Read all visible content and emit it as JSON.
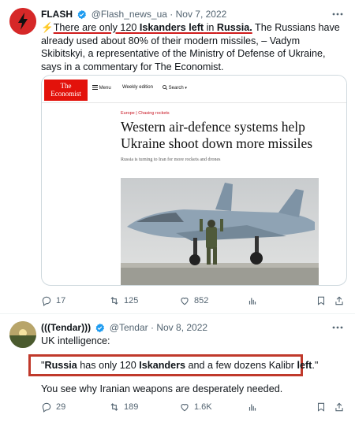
{
  "tweets": [
    {
      "name": "FLASH",
      "handle": "@Flash_news_ua",
      "separator": "·",
      "date": "Nov 7, 2022",
      "text": {
        "emoji": "⚡",
        "p1": "There are only 120 ",
        "p2": "Iskanders left",
        "p3": " in ",
        "p4": "Russia.",
        "p5": " The Russians have already used about 80% of their modern missiles, – Vadym Skibitskyi, a representative of the Ministry of Defense of Ukraine, says in a commentary for The Economist."
      },
      "card": {
        "logo_line1": "The",
        "logo_line2": "Economist",
        "menu": "Menu",
        "weekly": "Weekly edition",
        "search": "Search",
        "kicker": "Europe | Chasing rockets",
        "headline": "Western air-defence systems help Ukraine shoot down more missiles",
        "subhead": "Russia is turning to Iran for more rockets and drones"
      },
      "actions": {
        "replies": "17",
        "retweets": "125",
        "likes": "852"
      }
    },
    {
      "name": "(((Tendar)))",
      "handle": "@Tendar",
      "separator": "·",
      "date": "Nov 8, 2022",
      "line1": "UK intelligence:",
      "quote": {
        "q_open": "\"",
        "w1": "Russia",
        "w2": " has only 120 ",
        "w3": "Iskanders",
        "w4": " and a few dozens Kalibr ",
        "w5": "left",
        "q_close": ".\""
      },
      "line3": "You see why Iranian weapons are desperately needed.",
      "actions": {
        "replies": "29",
        "retweets": "189",
        "likes": "1.6K"
      }
    }
  ],
  "colors": {
    "verified": "#1d9bf0",
    "highlight": "#c0392b",
    "economist_red": "#e3120b"
  }
}
